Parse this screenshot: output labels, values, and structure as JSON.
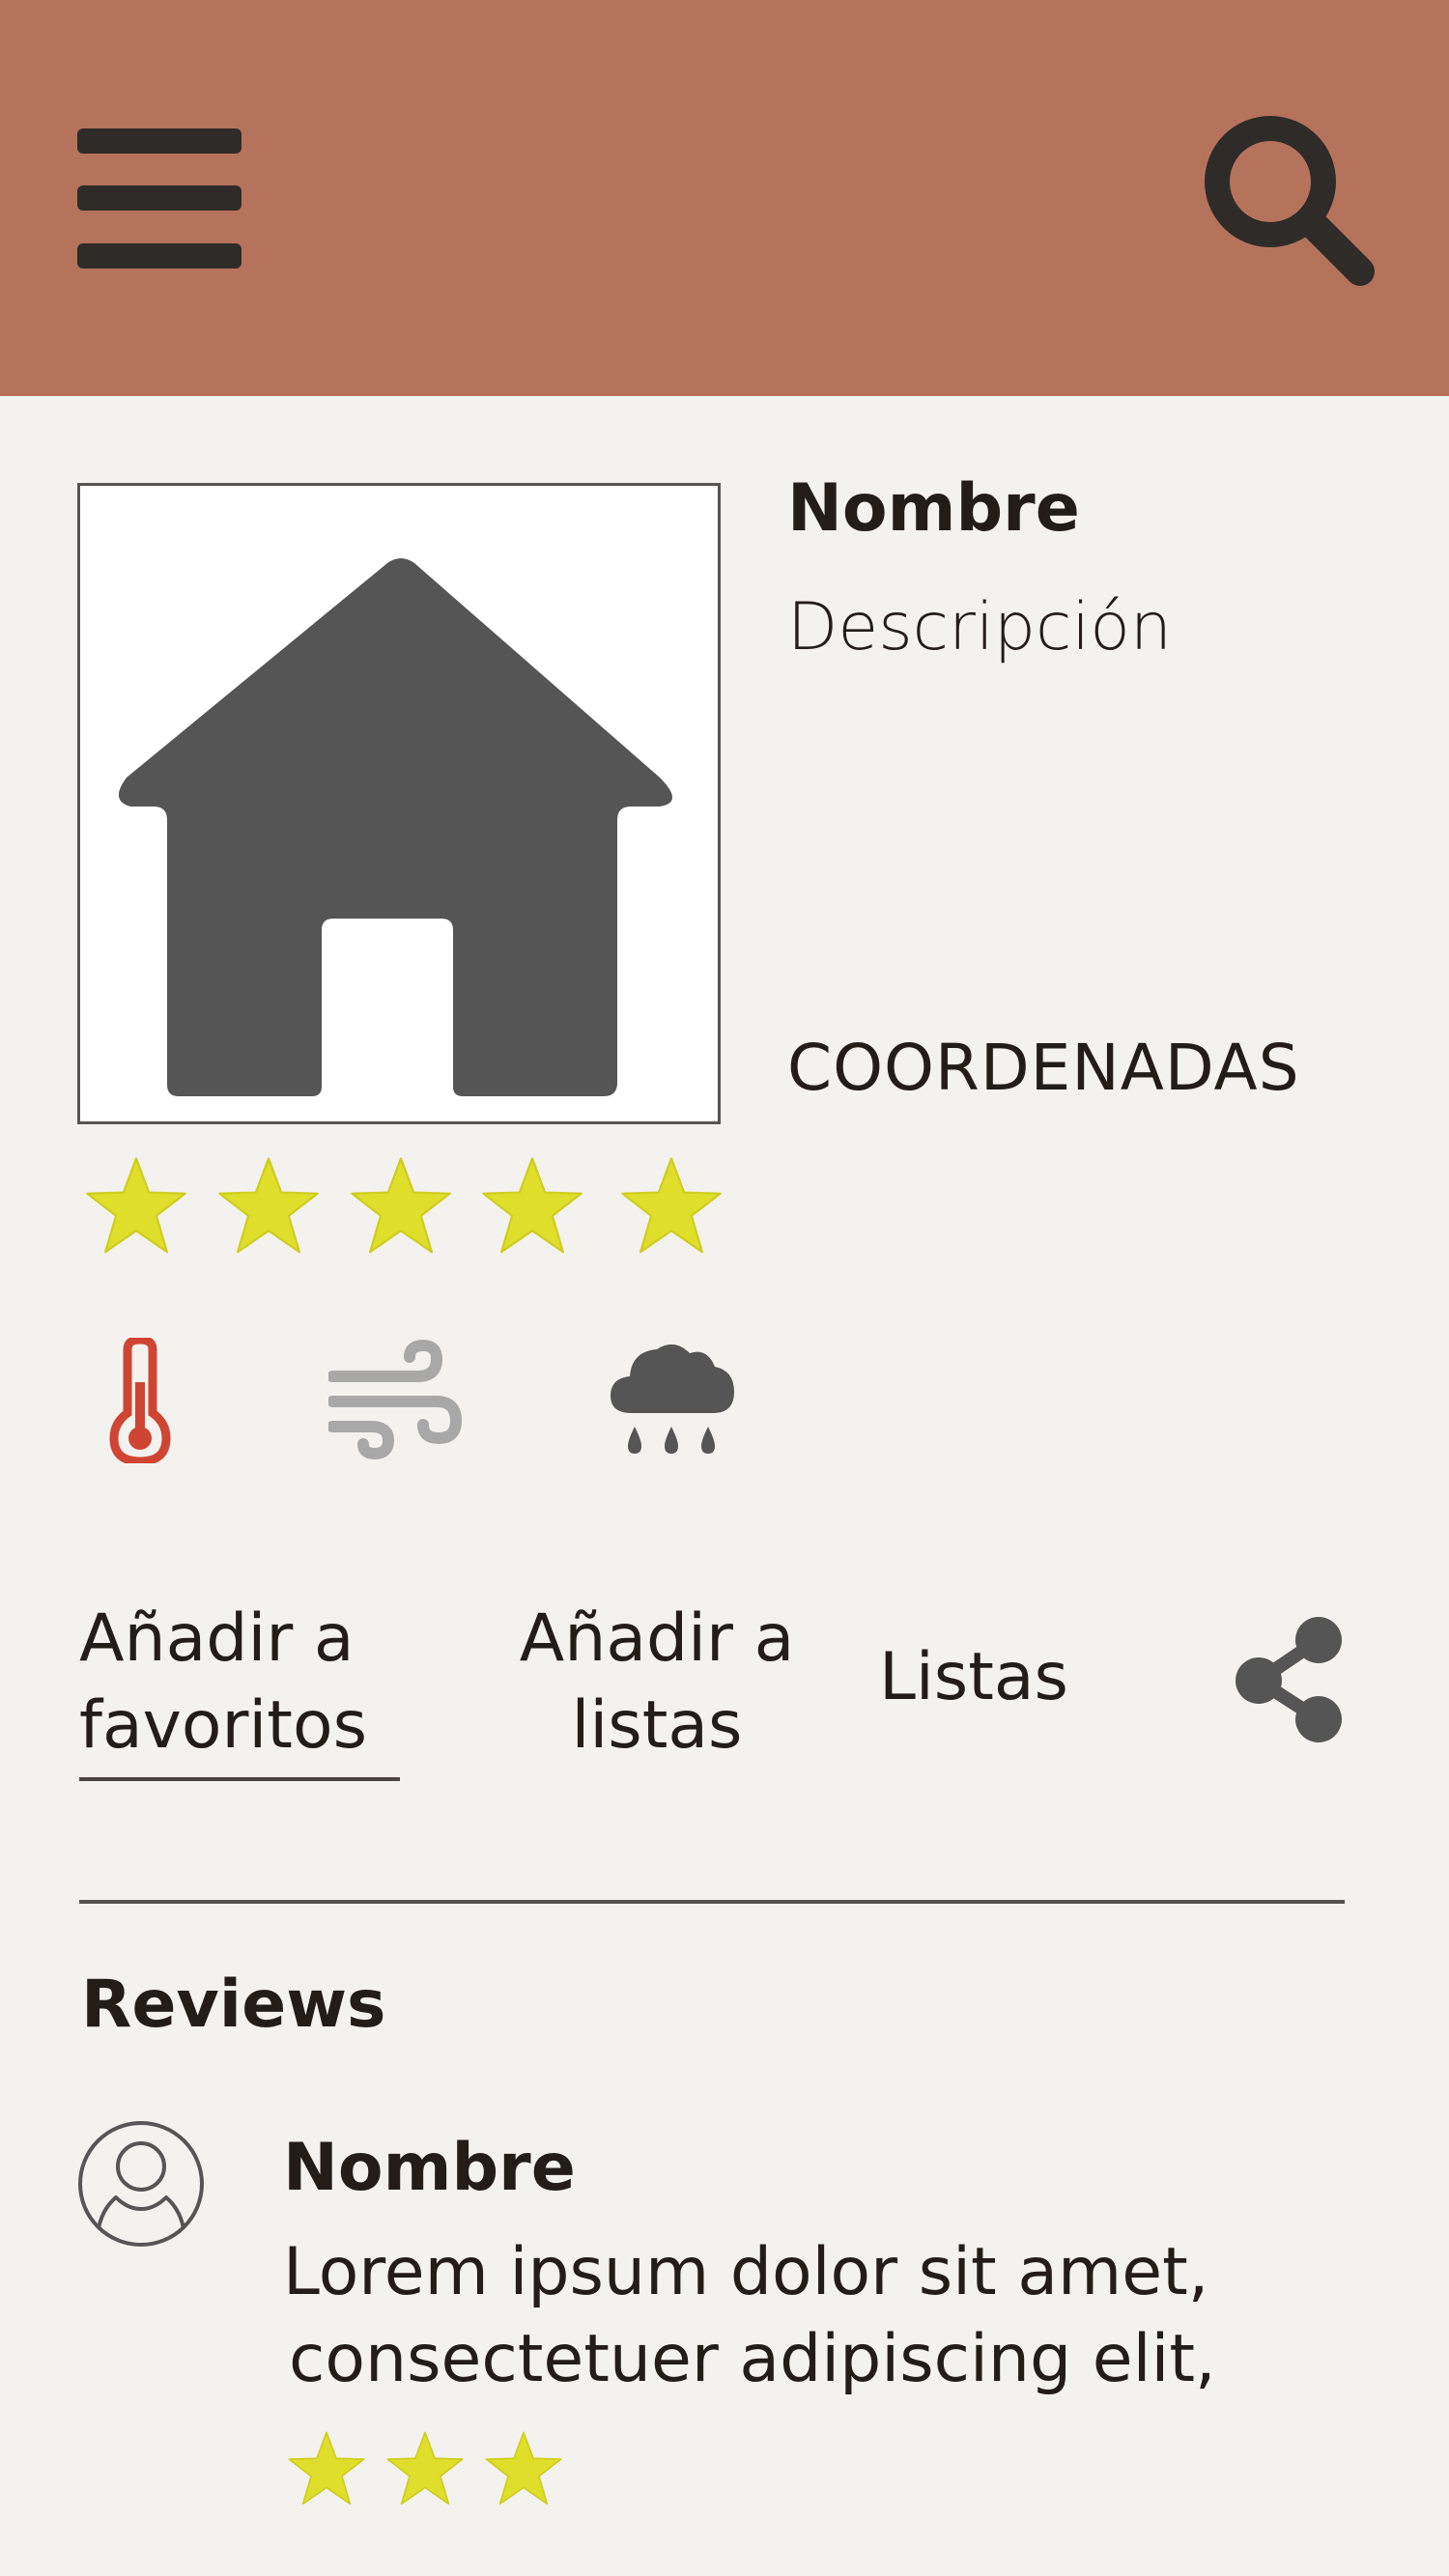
{
  "colors": {
    "header_bg": "#b5735c",
    "icon_dark": "#2f2b29",
    "image_icon": "#555555",
    "star": "#dfde2b",
    "thermometer": "#cf4533",
    "wind": "#a9a8a8",
    "rain": "#555555"
  },
  "header": {
    "menu_icon": "hamburger-icon",
    "search_icon": "search-icon"
  },
  "place": {
    "image_icon": "home-icon",
    "name": "Nombre",
    "description": "Descripción",
    "coordinates": "COORDENADAS",
    "rating": 5,
    "rating_max": 5
  },
  "weather": {
    "icons": [
      "thermometer-icon",
      "wind-icon",
      "rain-cloud-icon"
    ]
  },
  "actions": {
    "favorites_line1": "Añadir a",
    "favorites_line2": "favoritos",
    "add_list_line1": "Añadir a",
    "add_list_line2": "listas",
    "lists": "Listas",
    "share_icon": "share-icon"
  },
  "reviews": {
    "heading": "Reviews",
    "items": [
      {
        "avatar_icon": "user-avatar-icon",
        "name": "Nombre",
        "text_line1": "Lorem ipsum dolor sit amet,",
        "text_line2": "consectetuer adipiscing elit,",
        "rating": 3
      }
    ]
  }
}
